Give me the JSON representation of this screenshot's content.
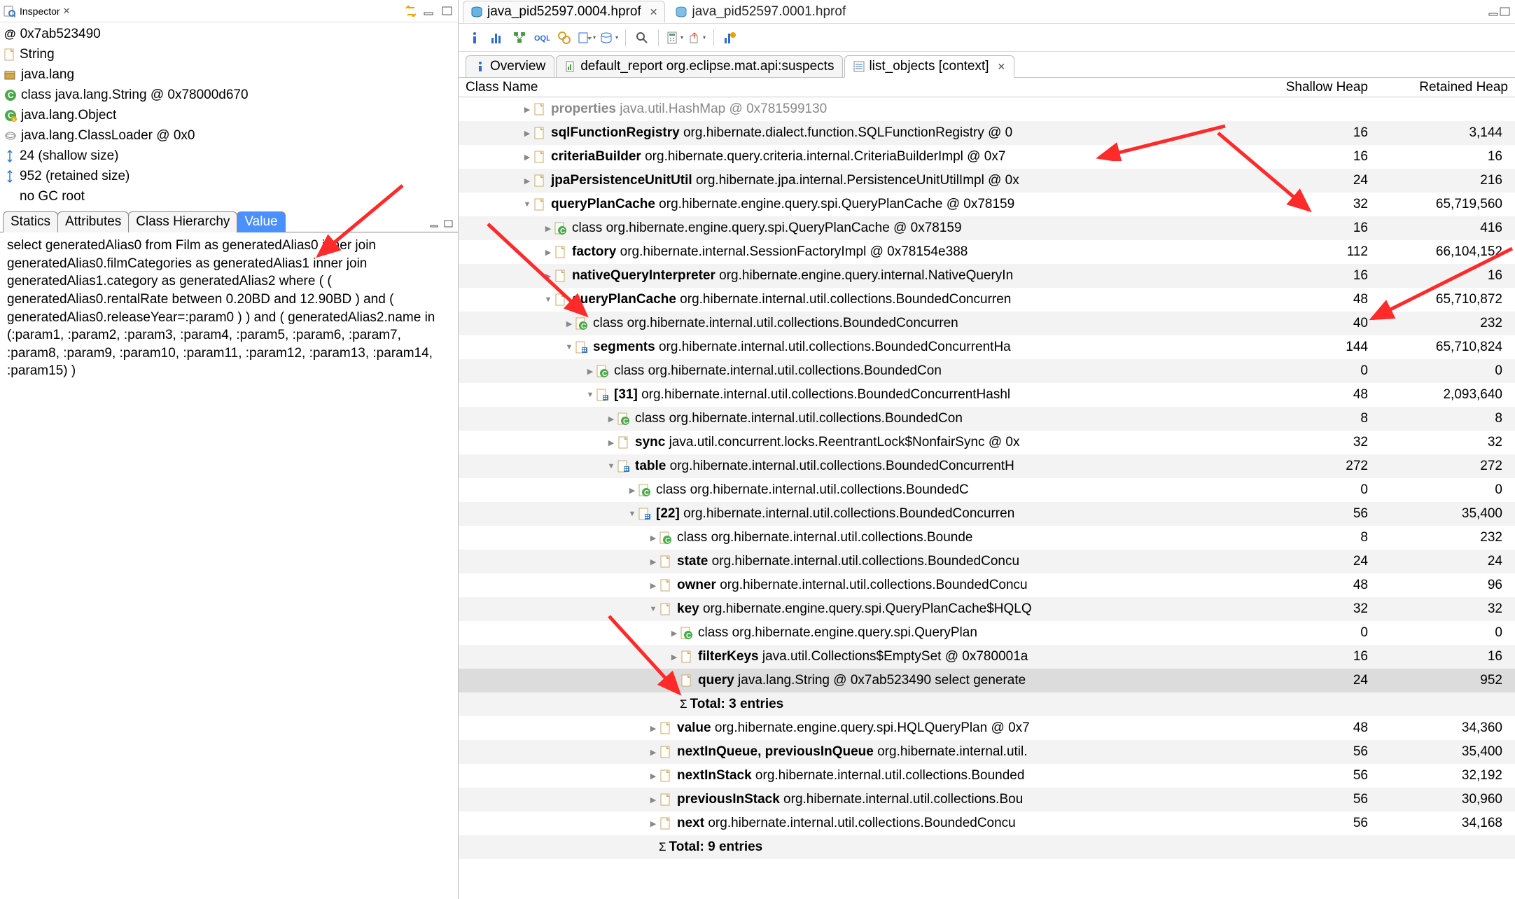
{
  "inspector": {
    "title": "Inspector",
    "rows": [
      {
        "icon": "at",
        "text": "0x7ab523490"
      },
      {
        "icon": "file",
        "text": "String"
      },
      {
        "icon": "pkg",
        "text": "java.lang"
      },
      {
        "icon": "class",
        "text": "class java.lang.String @ 0x78000d670"
      },
      {
        "icon": "super",
        "text": "java.lang.Object"
      },
      {
        "icon": "loader",
        "text": "java.lang.ClassLoader @ 0x0"
      },
      {
        "icon": "size",
        "text": "24 (shallow size)"
      },
      {
        "icon": "size",
        "text": "952 (retained size)"
      },
      {
        "icon": "blank",
        "text": "no GC root"
      }
    ],
    "tabs": [
      "Statics",
      "Attributes",
      "Class Hierarchy",
      "Value"
    ],
    "selected_tab": "Value",
    "value_text": "select generatedAlias0 from Film as generatedAlias0 inner join generatedAlias0.filmCategories as generatedAlias1 inner join generatedAlias1.category as generatedAlias2 where ( ( generatedAlias0.rentalRate between 0.20BD and 12.90BD ) and ( generatedAlias0.releaseYear=:param0 ) ) and ( generatedAlias2.name in (:param1, :param2, :param3, :param4, :param5, :param6, :param7, :param8, :param9, :param10, :param11, :param12, :param13, :param14, :param15) )"
  },
  "editor": {
    "tabs": [
      {
        "label": "java_pid52597.0004.hprof",
        "active": true
      },
      {
        "label": "java_pid52597.0001.hprof",
        "active": false
      }
    ]
  },
  "subtabs": [
    {
      "icon": "info",
      "label": "Overview",
      "active": false
    },
    {
      "icon": "report",
      "label": "default_report  org.eclipse.mat.api:suspects",
      "active": false
    },
    {
      "icon": "list",
      "label": "list_objects  [context]",
      "close": true,
      "active": true
    }
  ],
  "table": {
    "columns": [
      "Class Name",
      "Shallow Heap",
      "Retained Heap"
    ],
    "rows": [
      {
        "d": 2,
        "tw": "c",
        "i": "f",
        "name": "properties",
        "rest": " java.util.HashMap @ 0x781599130",
        "sh": "",
        "rh": "",
        "dim": true
      },
      {
        "d": 2,
        "tw": "c",
        "i": "f",
        "name": "sqlFunctionRegistry",
        "rest": " org.hibernate.dialect.function.SQLFunctionRegistry @ 0",
        "sh": "16",
        "rh": "3,144"
      },
      {
        "d": 2,
        "tw": "c",
        "i": "f",
        "name": "criteriaBuilder",
        "rest": " org.hibernate.query.criteria.internal.CriteriaBuilderImpl @ 0x7",
        "sh": "16",
        "rh": "16"
      },
      {
        "d": 2,
        "tw": "c",
        "i": "f",
        "name": "jpaPersistenceUnitUtil",
        "rest": " org.hibernate.jpa.internal.PersistenceUnitUtilImpl @ 0x",
        "sh": "24",
        "rh": "216"
      },
      {
        "d": 2,
        "tw": "o",
        "i": "f",
        "name": "queryPlanCache",
        "rest": " org.hibernate.engine.query.spi.QueryPlanCache @ 0x78159",
        "sh": "32",
        "rh": "65,719,560"
      },
      {
        "d": 3,
        "tw": "c",
        "i": "c",
        "name": "<class>",
        "rest": " class org.hibernate.engine.query.spi.QueryPlanCache @ 0x78159",
        "sh": "16",
        "rh": "416"
      },
      {
        "d": 3,
        "tw": "c",
        "i": "f",
        "name": "factory",
        "rest": " org.hibernate.internal.SessionFactoryImpl @ 0x78154e388",
        "sh": "112",
        "rh": "66,104,152"
      },
      {
        "d": 3,
        "tw": "c",
        "i": "f",
        "name": "nativeQueryInterpreter",
        "rest": " org.hibernate.engine.query.internal.NativeQueryIn",
        "sh": "16",
        "rh": "16"
      },
      {
        "d": 3,
        "tw": "o",
        "i": "f",
        "name": "queryPlanCache",
        "rest": " org.hibernate.internal.util.collections.BoundedConcurren",
        "sh": "48",
        "rh": "65,710,872"
      },
      {
        "d": 4,
        "tw": "c",
        "i": "c",
        "name": "<class>",
        "rest": " class org.hibernate.internal.util.collections.BoundedConcurren",
        "sh": "40",
        "rh": "232"
      },
      {
        "d": 4,
        "tw": "o",
        "i": "a",
        "name": "segments",
        "rest": " org.hibernate.internal.util.collections.BoundedConcurrentHa",
        "sh": "144",
        "rh": "65,710,824"
      },
      {
        "d": 5,
        "tw": "c",
        "i": "c",
        "name": "<class>",
        "rest": " class org.hibernate.internal.util.collections.BoundedCon",
        "sh": "0",
        "rh": "0"
      },
      {
        "d": 5,
        "tw": "o",
        "i": "a",
        "name": "[31]",
        "rest": " org.hibernate.internal.util.collections.BoundedConcurrentHashl",
        "sh": "48",
        "rh": "2,093,640"
      },
      {
        "d": 6,
        "tw": "c",
        "i": "c",
        "name": "<class>",
        "rest": " class org.hibernate.internal.util.collections.BoundedCon",
        "sh": "8",
        "rh": "8"
      },
      {
        "d": 6,
        "tw": "c",
        "i": "f",
        "name": "sync",
        "rest": " java.util.concurrent.locks.ReentrantLock$NonfairSync @ 0x",
        "sh": "32",
        "rh": "32"
      },
      {
        "d": 6,
        "tw": "o",
        "i": "a",
        "name": "table",
        "rest": " org.hibernate.internal.util.collections.BoundedConcurrentH",
        "sh": "272",
        "rh": "272"
      },
      {
        "d": 7,
        "tw": "c",
        "i": "c",
        "name": "<class>",
        "rest": " class org.hibernate.internal.util.collections.BoundedC",
        "sh": "0",
        "rh": "0"
      },
      {
        "d": 7,
        "tw": "o",
        "i": "a",
        "name": "[22]",
        "rest": " org.hibernate.internal.util.collections.BoundedConcurren",
        "sh": "56",
        "rh": "35,400"
      },
      {
        "d": 8,
        "tw": "c",
        "i": "c",
        "name": "<class>",
        "rest": " class org.hibernate.internal.util.collections.Bounde",
        "sh": "8",
        "rh": "232"
      },
      {
        "d": 8,
        "tw": "c",
        "i": "f",
        "name": "state",
        "rest": " org.hibernate.internal.util.collections.BoundedConcu",
        "sh": "24",
        "rh": "24"
      },
      {
        "d": 8,
        "tw": "c",
        "i": "f",
        "name": "owner",
        "rest": " org.hibernate.internal.util.collections.BoundedConcu",
        "sh": "48",
        "rh": "96"
      },
      {
        "d": 8,
        "tw": "o",
        "i": "f",
        "name": "key",
        "rest": " org.hibernate.engine.query.spi.QueryPlanCache$HQLQ",
        "sh": "32",
        "rh": "32"
      },
      {
        "d": 9,
        "tw": "c",
        "i": "c",
        "name": "<class>",
        "rest": " class org.hibernate.engine.query.spi.QueryPlan",
        "sh": "0",
        "rh": "0"
      },
      {
        "d": 9,
        "tw": "c",
        "i": "f",
        "name": "filterKeys",
        "rest": " java.util.Collections$EmptySet @ 0x780001a",
        "sh": "16",
        "rh": "16"
      },
      {
        "d": 9,
        "tw": "c",
        "i": "f",
        "name": "query",
        "rest": " java.lang.String @ 0x7ab523490  select generate",
        "sh": "24",
        "rh": "952",
        "sel": true
      },
      {
        "d": 9,
        "tw": "s",
        "i": "",
        "name": "",
        "rest": "Total: 3 entries",
        "sh": "",
        "rh": "",
        "sigma": true
      },
      {
        "d": 8,
        "tw": "c",
        "i": "f",
        "name": "value",
        "rest": " org.hibernate.engine.query.spi.HQLQueryPlan @ 0x7",
        "sh": "48",
        "rh": "34,360"
      },
      {
        "d": 8,
        "tw": "c",
        "i": "f",
        "name": "nextInQueue, previousInQueue",
        "rest": " org.hibernate.internal.util.",
        "sh": "56",
        "rh": "35,400"
      },
      {
        "d": 8,
        "tw": "c",
        "i": "f",
        "name": "nextInStack",
        "rest": " org.hibernate.internal.util.collections.Bounded",
        "sh": "56",
        "rh": "32,192"
      },
      {
        "d": 8,
        "tw": "c",
        "i": "f",
        "name": "previousInStack",
        "rest": " org.hibernate.internal.util.collections.Bou",
        "sh": "56",
        "rh": "30,960"
      },
      {
        "d": 8,
        "tw": "c",
        "i": "f",
        "name": "next",
        "rest": " org.hibernate.internal.util.collections.BoundedConcu",
        "sh": "56",
        "rh": "34,168"
      },
      {
        "d": 8,
        "tw": "s",
        "i": "",
        "name": "",
        "rest": "Total: 9 entries",
        "sh": "",
        "rh": "",
        "sigma": true
      }
    ]
  }
}
